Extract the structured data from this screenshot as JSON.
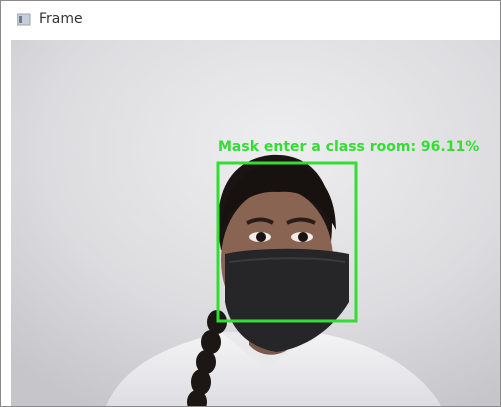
{
  "window": {
    "title": "Frame"
  },
  "detection": {
    "label": "Mask enter a class room: 96.11%",
    "box_color": "#33dd33"
  }
}
